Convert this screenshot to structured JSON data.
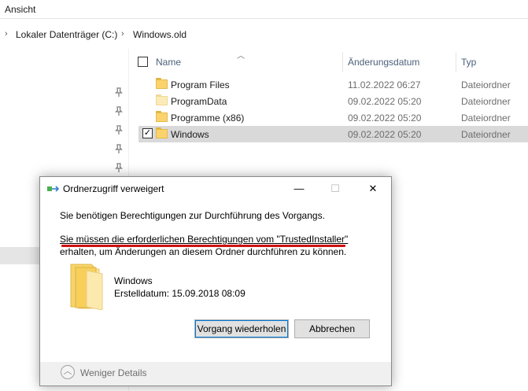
{
  "ribbon": {
    "tab_label": "Ansicht"
  },
  "address": {
    "segments": [
      "Lokaler Datenträger (C:)",
      "Windows.old"
    ],
    "chevron": "›"
  },
  "columns": {
    "name": "Name",
    "date": "Änderungsdatum",
    "type": "Typ"
  },
  "files": [
    {
      "name": "Program Files",
      "date": "11.02.2022 06:27",
      "type": "Dateiordner",
      "selected": false
    },
    {
      "name": "ProgramData",
      "date": "09.02.2022 05:20",
      "type": "Dateiordner",
      "selected": false
    },
    {
      "name": "Programme (x86)",
      "date": "09.02.2022 05:20",
      "type": "Dateiordner",
      "selected": false
    },
    {
      "name": "Windows",
      "date": "09.02.2022 05:20",
      "type": "Dateiordner",
      "selected": true
    }
  ],
  "dialog": {
    "title": "Ordnerzugriff verweigert",
    "line1": "Sie benötigen Berechtigungen zur Durchführung des Vorgangs.",
    "line2": "Sie müssen die erforderlichen Berechtigungen vom \"TrustedInstaller\"",
    "line3": "erhalten, um Änderungen an diesem Ordner durchführen zu können.",
    "item_name": "Windows",
    "item_created": "Erstelldatum: 15.09.2018 08:09",
    "retry_label": "Vorgang wiederholen",
    "cancel_label": "Abbrechen",
    "less_details_label": "Weniger Details",
    "minimize_glyph": "—",
    "maximize_glyph": "☐",
    "close_glyph": "✕",
    "less_glyph": "︿"
  },
  "colors": {
    "selection": "#d9d9d9",
    "highlight_underline": "#d01010",
    "folder": "#fbd36d",
    "header_text": "#4c607a"
  },
  "icons": {
    "pin": "pin-icon",
    "folder": "folder-icon",
    "check": "✓"
  }
}
